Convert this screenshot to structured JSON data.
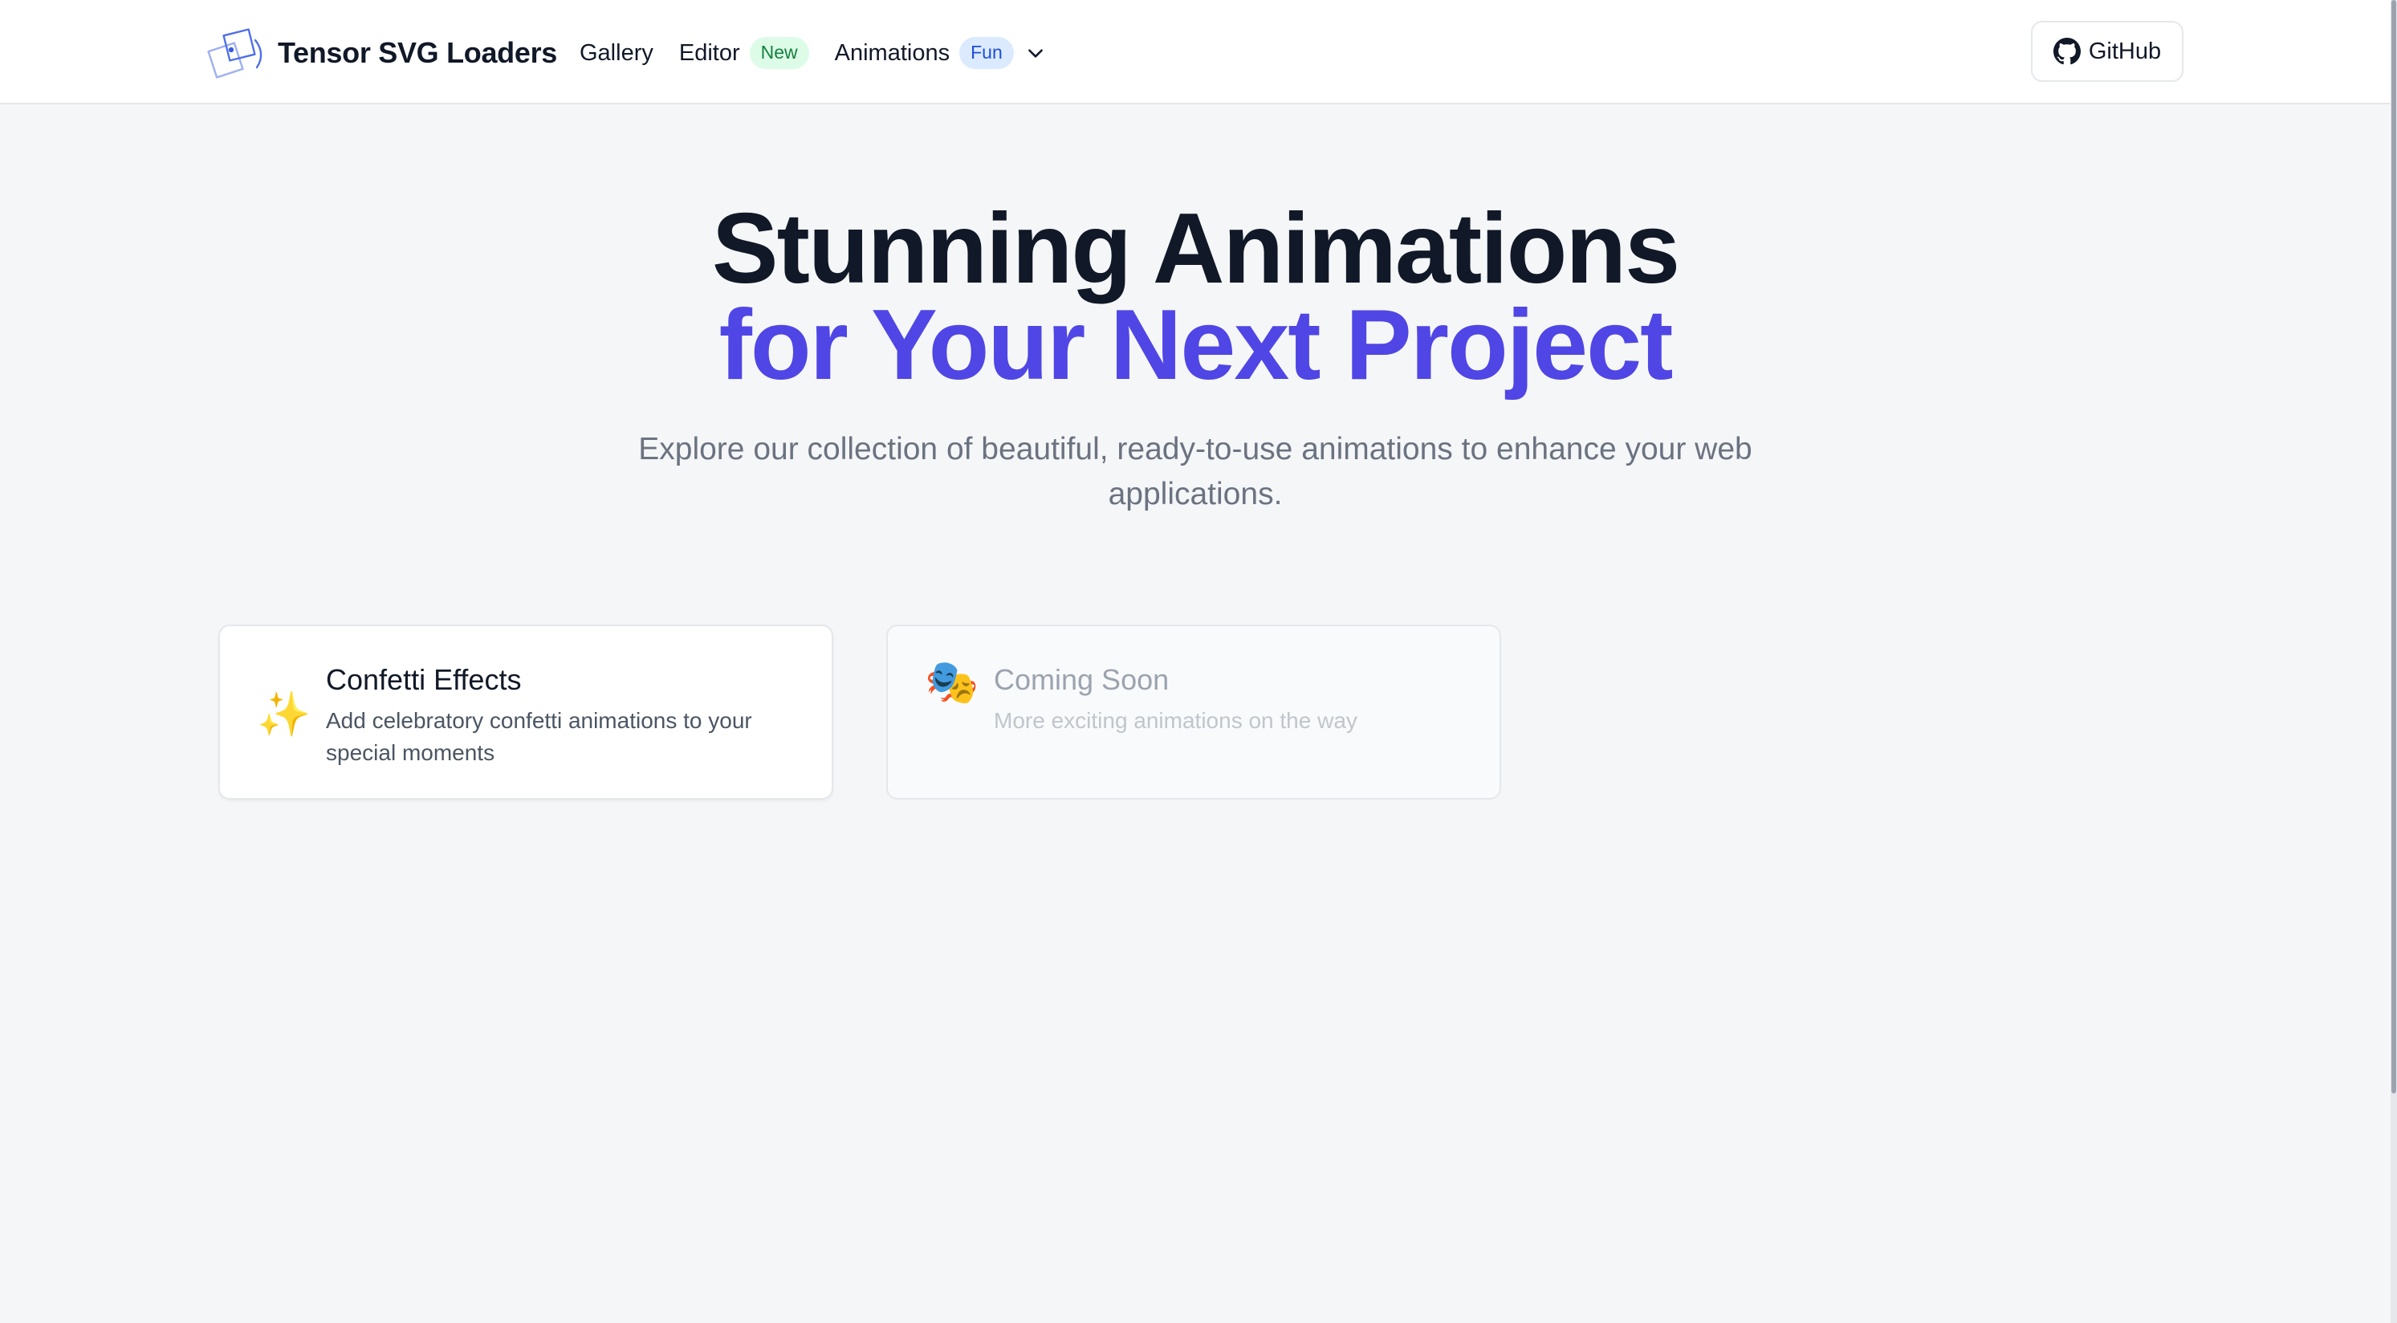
{
  "header": {
    "brand": {
      "logo_icon": "stacked-squares-logo-icon",
      "name": "Tensor SVG Loaders"
    },
    "nav": [
      {
        "label": "Gallery"
      },
      {
        "label": "Editor",
        "badge": "New"
      },
      {
        "label": "Animations",
        "badge": "Fun",
        "icon": "chevron-down-icon"
      }
    ],
    "github": {
      "icon": "github-icon",
      "label": "GitHub"
    }
  },
  "hero": {
    "title_line1": "Stunning Animations",
    "title_line2": "for Your Next Project",
    "subtitle": "Explore our collection of beautiful, ready-to-use animations to enhance your web applications."
  },
  "cards": [
    {
      "icon": "✨",
      "icon_name": "sparkles-icon",
      "title": "Confetti Effects",
      "description": "Add celebratory confetti animations to your special moments"
    },
    {
      "icon": "🎭",
      "icon_name": "theater-masks-icon",
      "title": "Coming Soon",
      "description": "More exciting animations on the way"
    }
  ],
  "colors": {
    "accent": "#4f46e5",
    "heading": "#111827",
    "muted": "#6b7280",
    "badge_new_bg": "#dcfce7",
    "badge_new_text": "#15803d",
    "badge_fun_bg": "#dbeafe",
    "badge_fun_text": "#1d4ed8",
    "page_bg": "#f5f6f8"
  }
}
